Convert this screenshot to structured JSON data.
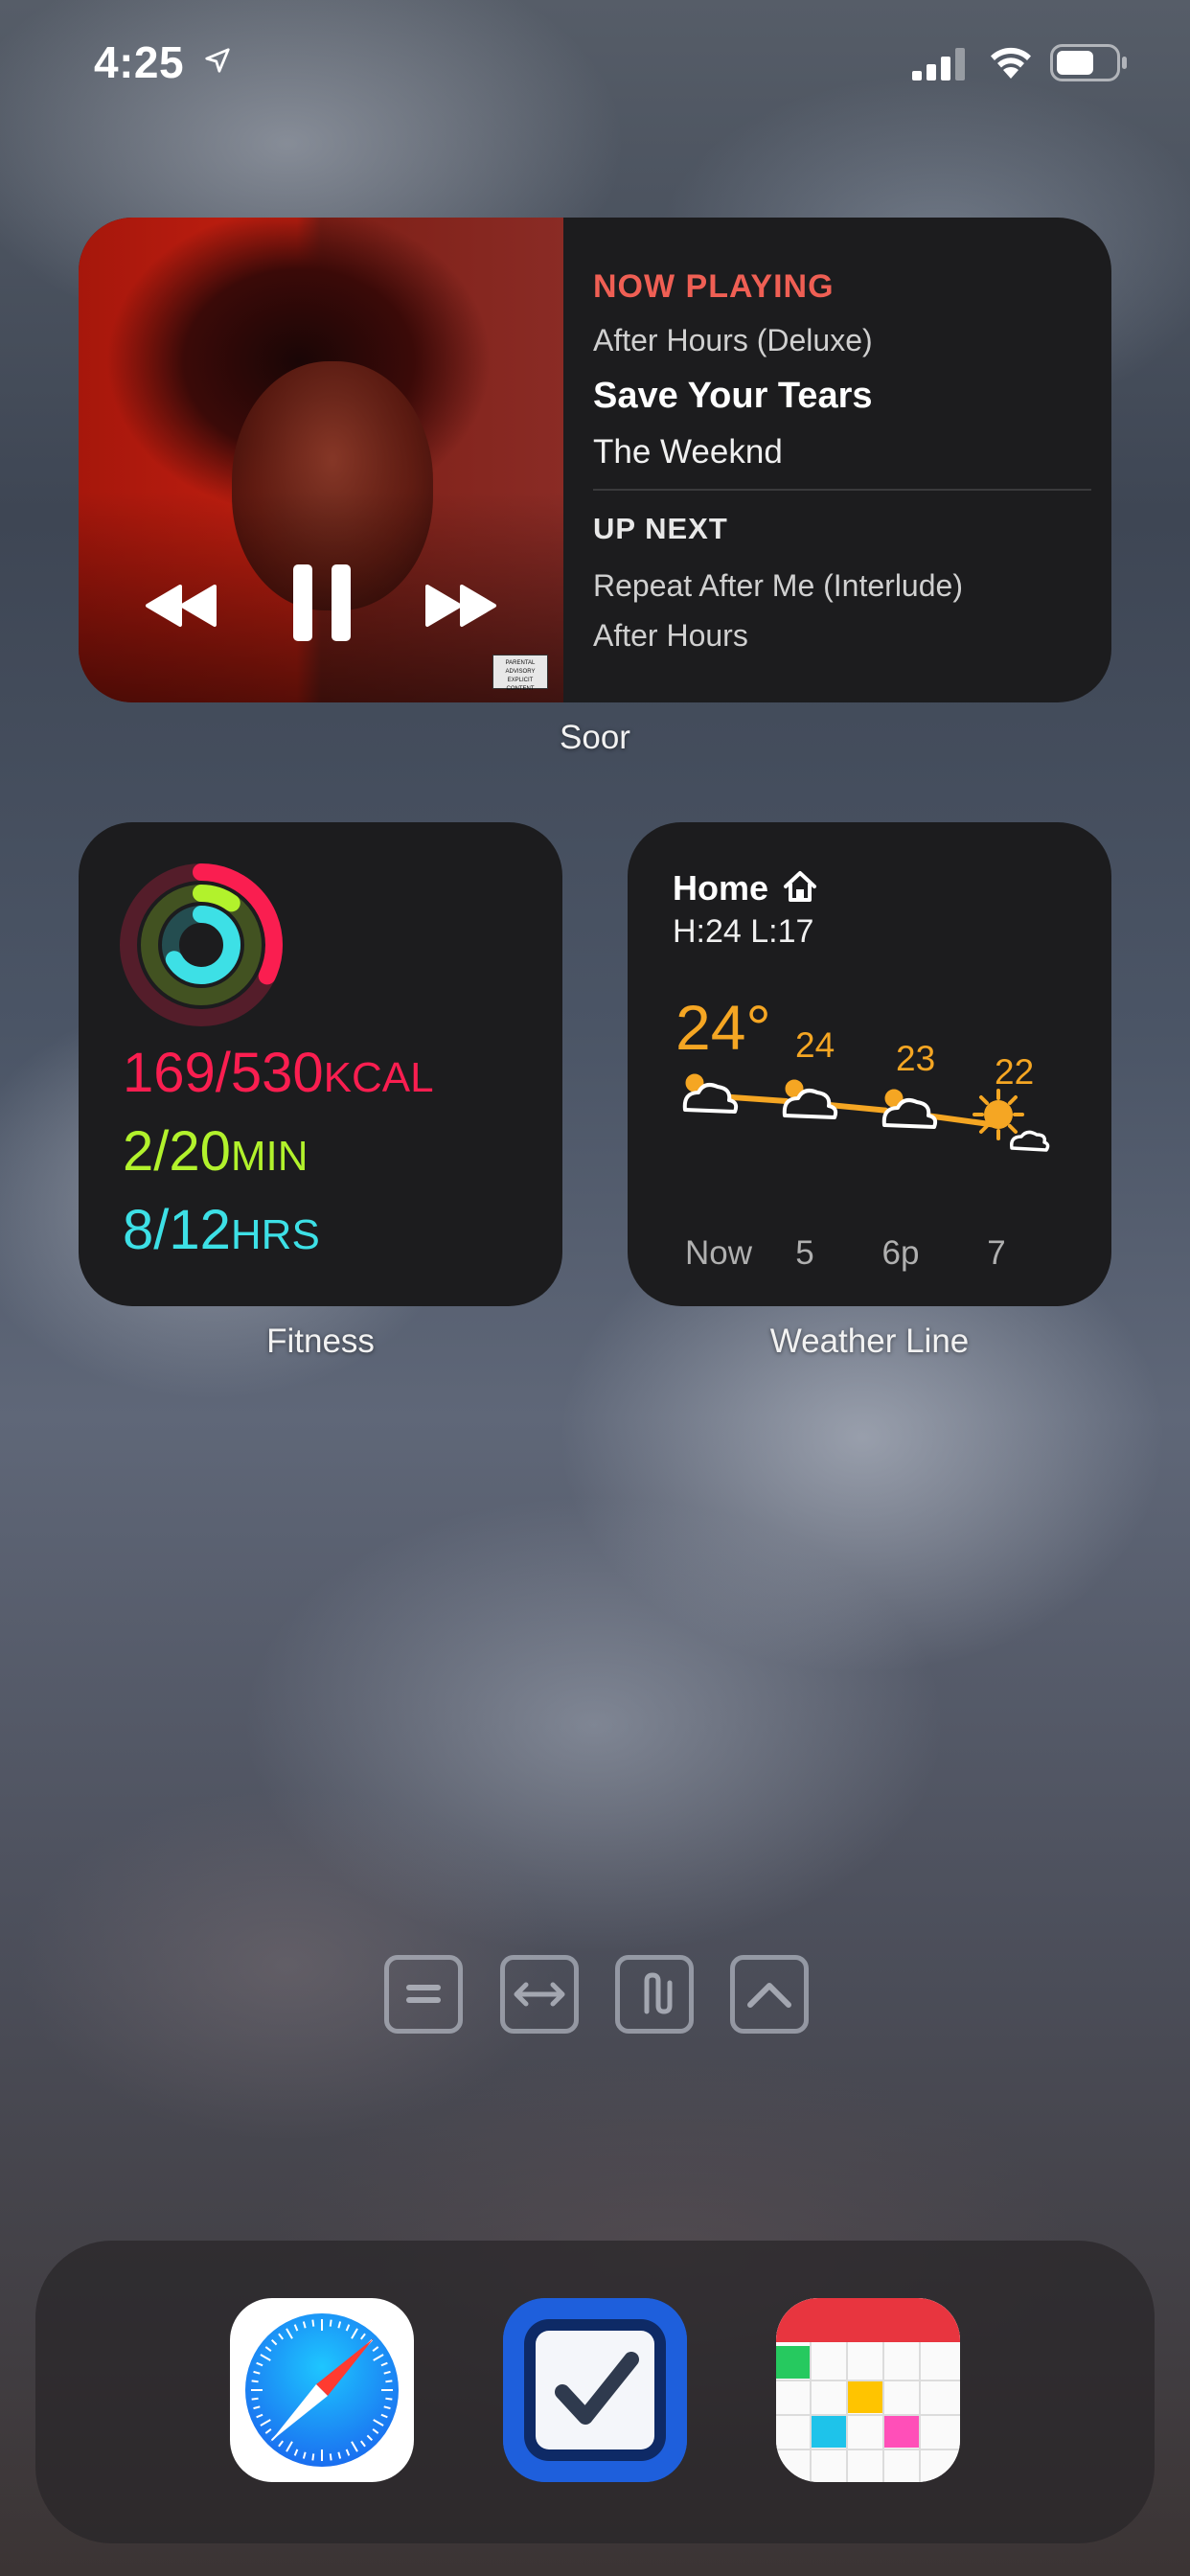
{
  "status_bar": {
    "time": "4:25",
    "icons": [
      "location-arrow-icon",
      "cellular-signal-icon",
      "wifi-icon",
      "battery-icon"
    ]
  },
  "now_playing_widget": {
    "header": "NOW PLAYING",
    "album": "After Hours (Deluxe)",
    "title": "Save Your Tears",
    "artist": "The Weeknd",
    "up_next_header": "UP NEXT",
    "up_next_song": "Repeat After Me (Interlude)",
    "up_next_album": "After Hours",
    "advisory_text": "PARENTAL ADVISORY EXPLICIT CONTENT",
    "label": "Soor"
  },
  "fitness_widget": {
    "move": {
      "value": "169/530",
      "unit": "KCAL",
      "progress": 0.32
    },
    "exercise": {
      "value": "2/20",
      "unit": "MIN",
      "progress": 0.1
    },
    "stand": {
      "value": "8/12",
      "unit": "HRS",
      "progress": 0.67
    },
    "label": "Fitness"
  },
  "weather_widget": {
    "location": "Home",
    "hi_lo": "H:24 L:17",
    "now_temp": "24°",
    "forecast_temps": [
      "24",
      "23",
      "22"
    ],
    "times": [
      "Now",
      "5",
      "6p",
      "7"
    ],
    "label": "Weather Line"
  },
  "page_indicator": {
    "icons": [
      "menu-lines-icon",
      "horizontal-arrows-icon",
      "paperclip-icon",
      "chevron-up-icon"
    ]
  },
  "dock": {
    "apps": [
      "Safari",
      "Tasks",
      "Fantastical"
    ]
  },
  "colors": {
    "accent_red": "#ef5f54",
    "move_ring": "#fa1e50",
    "exercise_ring": "#b2f22c",
    "stand_ring": "#3de0e6",
    "weather_orange": "#f5a623"
  }
}
